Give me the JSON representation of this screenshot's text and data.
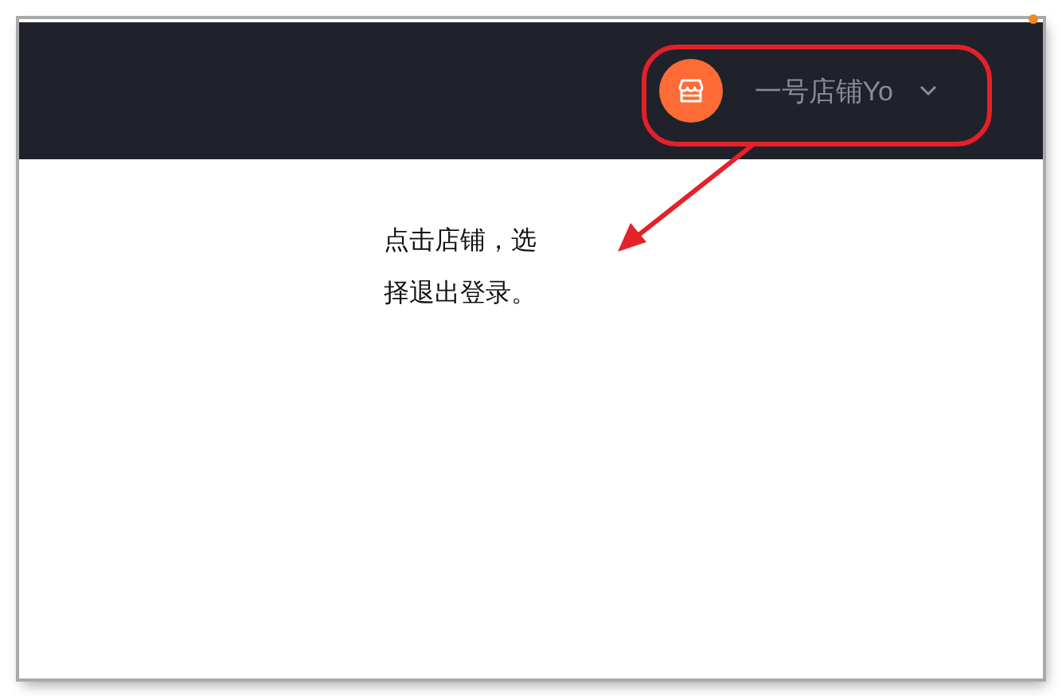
{
  "header": {
    "store": {
      "name": "一号店铺Yo"
    }
  },
  "annotation": {
    "text": "点击店铺，选择退出登录。"
  }
}
